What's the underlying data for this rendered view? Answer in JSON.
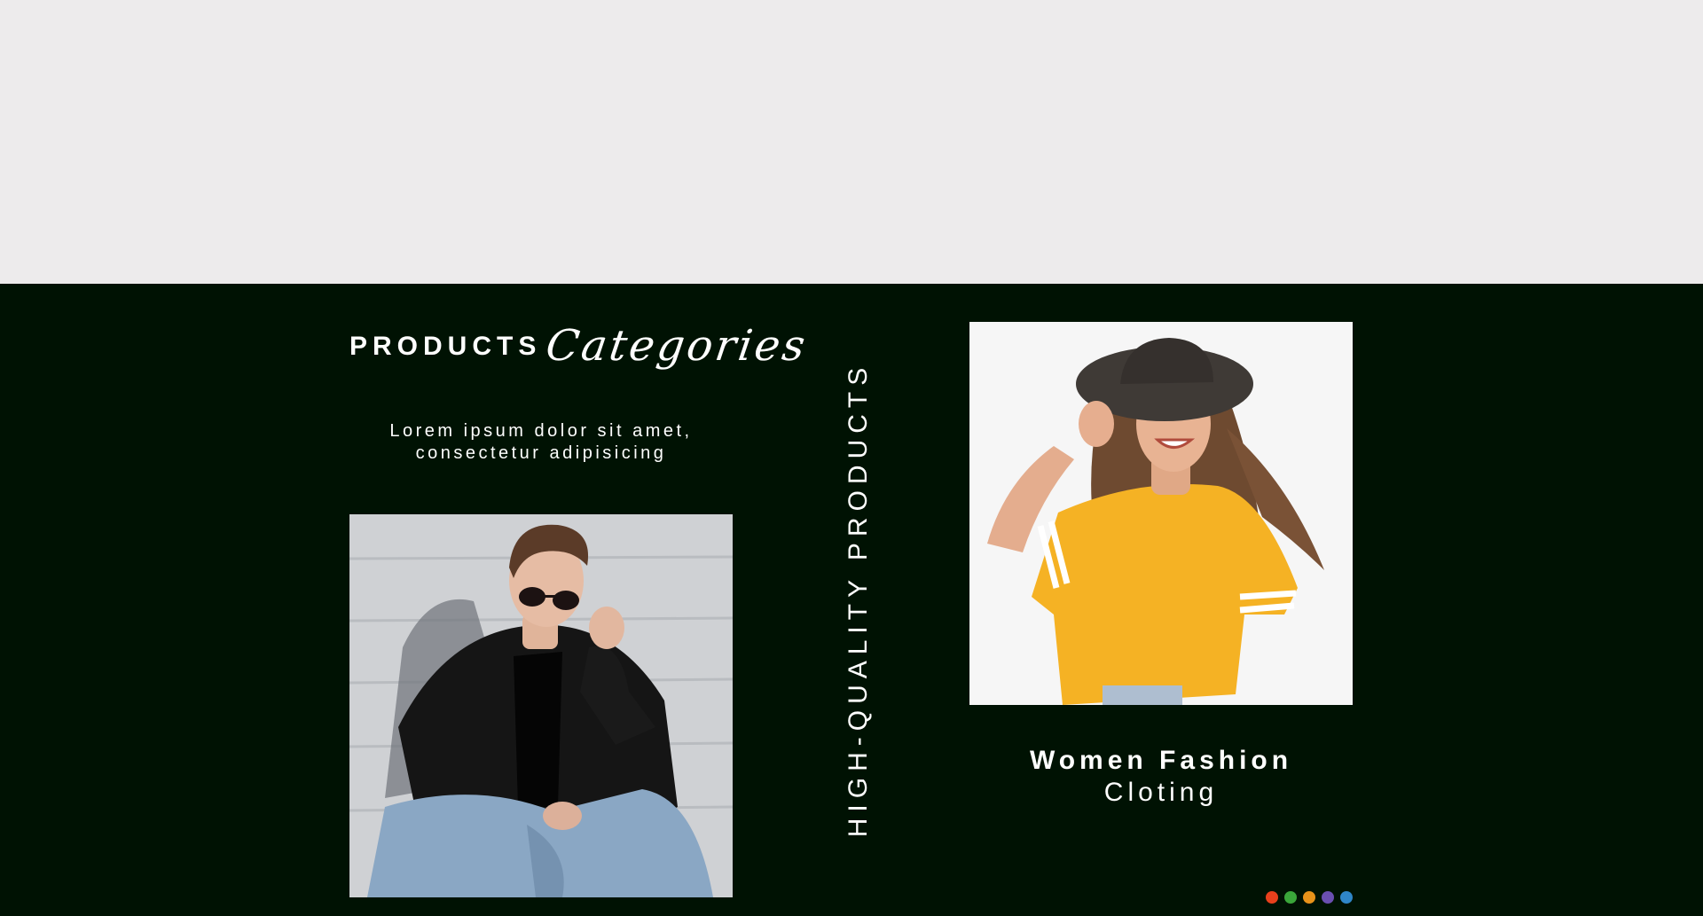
{
  "heading": {
    "bold": "PRODUCTS",
    "script": "Categories"
  },
  "intro": {
    "line1": "Lorem ipsum dolor sit amet,",
    "line2": "consectetur adipisicing"
  },
  "vertical_label": "HIGH-QUALITY PRODUCTS",
  "feature": {
    "title": "Women Fashion",
    "subtitle": "Cloting"
  },
  "photos": {
    "left": "man-in-sunglasses-photo",
    "right": "woman-in-hat-photo"
  },
  "colors": {
    "background_top": "#edebec",
    "background_dark": "#001203",
    "text": "#ffffff",
    "dots": [
      "#e8401c",
      "#3aa63a",
      "#e8921a",
      "#6a4fb0",
      "#2f86c8"
    ]
  }
}
